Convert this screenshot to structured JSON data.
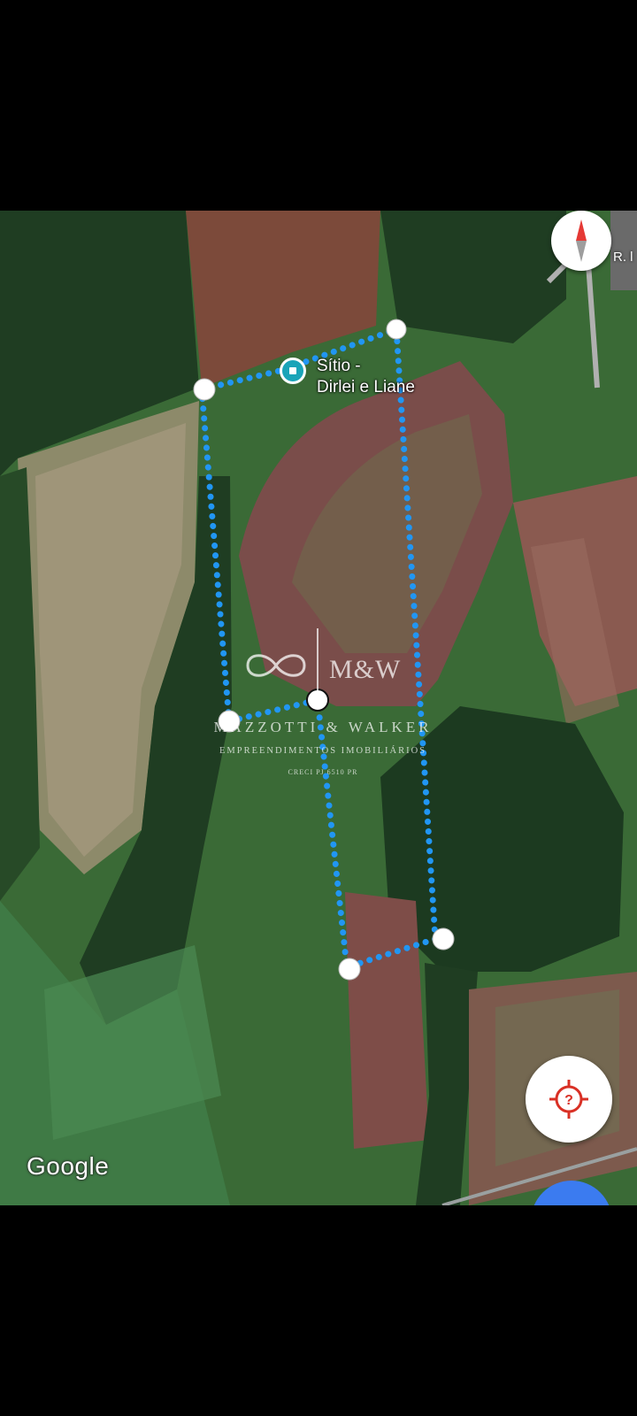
{
  "map": {
    "place_label": "Sítio -\nDirlei e Liane",
    "road_label": "R. l",
    "attribution": "Google",
    "map_type": "satellite",
    "icons": {
      "compass": "compass-icon",
      "place": "place-pin-icon",
      "locate": "my-location-icon"
    }
  },
  "watermark": {
    "brand": "M&W",
    "name": "MAZZOTTI & WALKER",
    "subtitle": "EMPREENDIMENTOS IMOBILIÁRIOS",
    "license": "CRECI PJ 6510 PR"
  },
  "colors": {
    "boundary_dots": "#2196f3",
    "vertex_fill": "#ffffff",
    "place_pin": "#1aa4b8",
    "locate_icon": "#d93025"
  }
}
